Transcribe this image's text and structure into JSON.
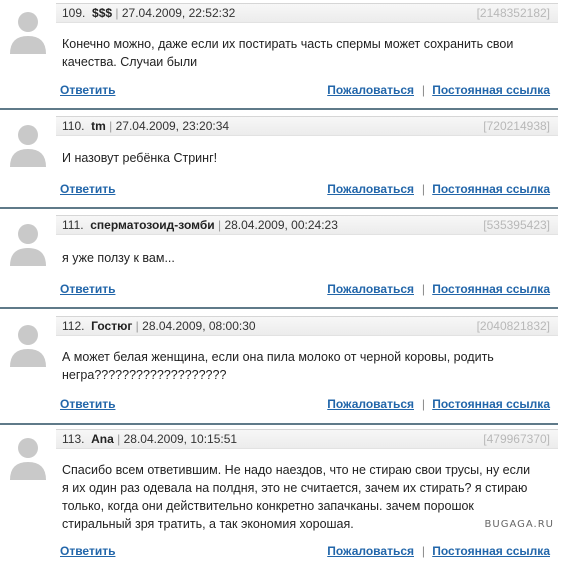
{
  "actions": {
    "reply": "Ответить",
    "report": "Пожаловаться",
    "separator": "|",
    "permalink": "Постоянная ссылка"
  },
  "comments": [
    {
      "number": "109.",
      "author": "$$$",
      "date": "27.04.2009, 22:52:32",
      "id": "[2148352182]",
      "lines": [
        "Конечно можно, даже если их постирать часть спермы может сохранить свои",
        "качества. Случаи были"
      ]
    },
    {
      "number": "110.",
      "author": "tm",
      "date": "27.04.2009, 23:20:34",
      "id": "[720214938]",
      "lines": [
        "И назовут ребёнка Стринг!"
      ]
    },
    {
      "number": "111.",
      "author": "сперматозоид-зомби",
      "date": "28.04.2009, 00:24:23",
      "id": "[535395423]",
      "lines": [
        "я уже ползу к вам..."
      ]
    },
    {
      "number": "112.",
      "author": "Гостюг",
      "date": "28.04.2009, 08:00:30",
      "id": "[2040821832]",
      "lines": [
        "А может белая женщина, если она пила молоко от черной коровы, родить",
        "негра???????????????????"
      ]
    },
    {
      "number": "113.",
      "author": "Ana",
      "date": "28.04.2009, 10:15:51",
      "id": "[479967370]",
      "lines": [
        "Спасибо всем ответившим. Не надо наездов, что не стираю свои трусы, ну если",
        "я их один раз одевала на полдня, это не считается, зачем их стирать? я стираю",
        "только, когда они действительно конкретно запачканы. зачем порошок",
        "стиральный зря тратить, а так экономия хорошая."
      ]
    }
  ],
  "watermark": "BUGAGA.RU"
}
